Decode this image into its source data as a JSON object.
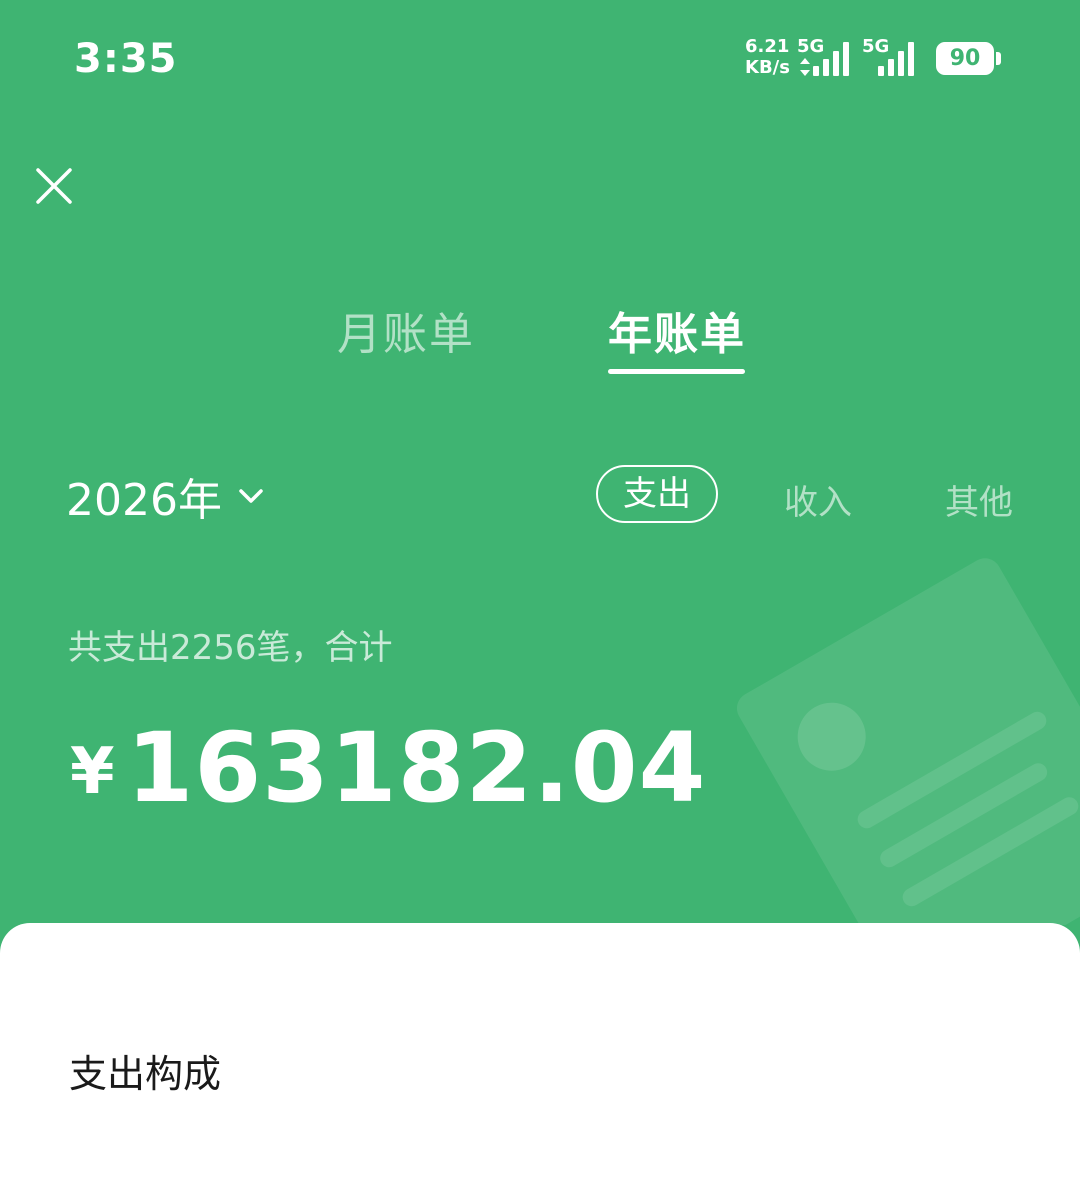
{
  "status_bar": {
    "time": "3:35",
    "net_speed_value": "6.21",
    "net_speed_unit": "KB/s",
    "sim1_label": "5G",
    "sim2_label": "5G",
    "battery": "90"
  },
  "header": {
    "close_icon": "close-icon"
  },
  "tabs": [
    {
      "label": "月账单",
      "active": false
    },
    {
      "label": "年账单",
      "active": true
    }
  ],
  "filter": {
    "year_label": "2026年",
    "chips": [
      {
        "label": "支出",
        "active": true
      },
      {
        "label": "收入",
        "active": false
      },
      {
        "label": "其他",
        "active": false
      }
    ]
  },
  "summary": {
    "description": "共支出2256笔，合计",
    "currency": "¥",
    "amount": "163182.04"
  },
  "card": {
    "title": "支出构成"
  },
  "colors": {
    "background": "#3fb472",
    "card": "#ffffff",
    "text": "#ffffff"
  }
}
